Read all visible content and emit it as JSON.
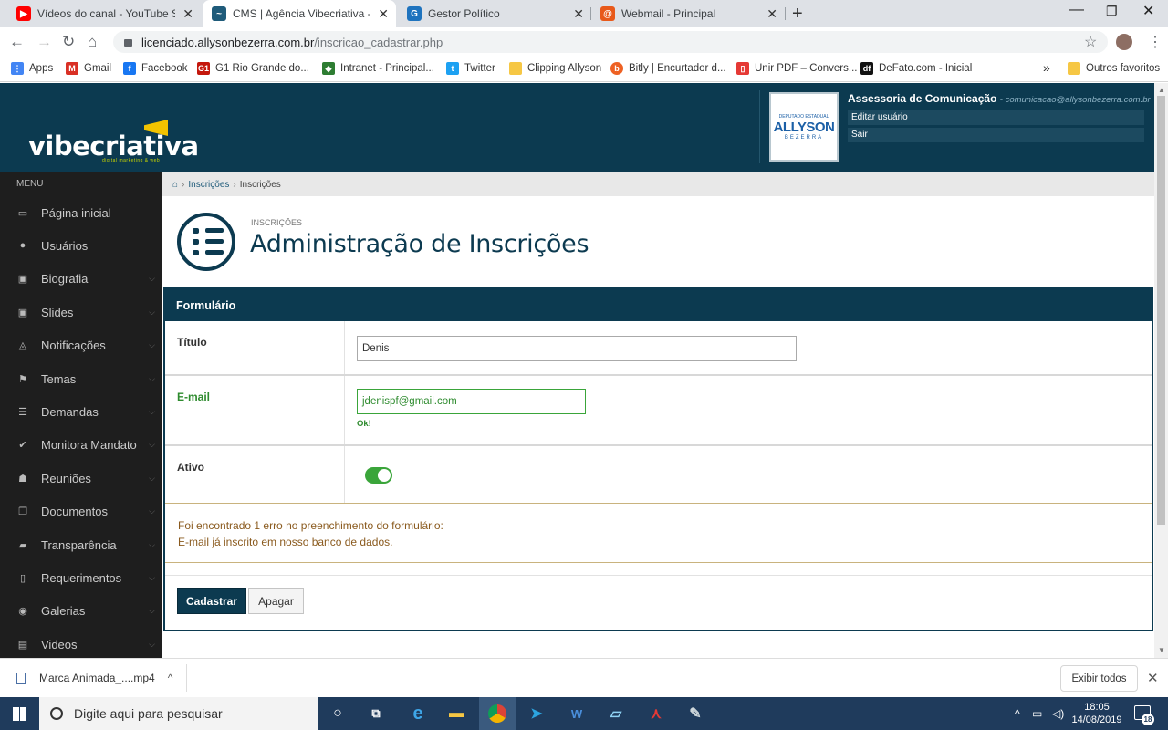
{
  "browser": {
    "tabs": [
      {
        "title": "Vídeos do canal - YouTube Studio",
        "icon": "youtube-icon",
        "color": "#ff0000"
      },
      {
        "title": "CMS | Agência Vibecriativa - digital",
        "icon": "vibecriativa-icon",
        "color": "#1f5b7a"
      },
      {
        "title": "Gestor Político",
        "icon": "gp-icon",
        "color": "#1e73be"
      },
      {
        "title": "Webmail - Principal",
        "icon": "webmail-icon",
        "color": "#e8591a"
      }
    ],
    "url_domain": "licenciado.allysonbezerra.com.br",
    "url_path": "/inscricao_cadastrar.php",
    "bookmarks": [
      {
        "label": "Apps",
        "icon": "apps-grid-icon",
        "color": "#4285f4"
      },
      {
        "label": "Gmail",
        "icon": "gmail-icon",
        "color": "#d93025"
      },
      {
        "label": "Facebook",
        "icon": "facebook-icon",
        "color": "#1877f2"
      },
      {
        "label": "G1 Rio Grande do...",
        "icon": "g1-icon",
        "color": "#c4170c"
      },
      {
        "label": "Intranet - Principal...",
        "icon": "intranet-icon",
        "color": "#2e7d32"
      },
      {
        "label": "Twitter",
        "icon": "twitter-icon",
        "color": "#1da1f2"
      },
      {
        "label": "Clipping Allyson",
        "icon": "folder-icon",
        "color": "#f6c744"
      },
      {
        "label": "Bitly | Encurtador d...",
        "icon": "bitly-icon",
        "color": "#ee6123"
      },
      {
        "label": "Unir PDF – Convers...",
        "icon": "pdf-icon",
        "color": "#e53935"
      },
      {
        "label": "DeFato.com - Inicial",
        "icon": "defato-icon",
        "color": "#111111"
      }
    ],
    "bookmarks_overflow": "»",
    "other_bookmarks": "Outros favoritos"
  },
  "header": {
    "logo_text": "vibecriativa",
    "logo_subtext": "digital marketing & web",
    "avatar": {
      "line1": "DEPUTADO ESTADUAL",
      "line2": "ALLYSON",
      "line3": "BEZERRA"
    },
    "user_name": "Assessoria de Comunicação",
    "user_email": "comunicacao@allysonbezerra.com.br",
    "menu": [
      "Editar usuário",
      "Sair"
    ]
  },
  "sidebar": {
    "title": "MENU",
    "items": [
      {
        "label": "Página inicial",
        "icon": "laptop-icon",
        "glyph": "▭",
        "has_submenu": false
      },
      {
        "label": "Usuários",
        "icon": "user-icon",
        "glyph": "●",
        "has_submenu": false
      },
      {
        "label": "Biografia",
        "icon": "image-icon",
        "glyph": "▣",
        "has_submenu": true
      },
      {
        "label": "Slides",
        "icon": "image-icon",
        "glyph": "▣",
        "has_submenu": true
      },
      {
        "label": "Notificações",
        "icon": "bell-icon",
        "glyph": "◬",
        "has_submenu": true
      },
      {
        "label": "Temas",
        "icon": "flag-icon",
        "glyph": "⚑",
        "has_submenu": true
      },
      {
        "label": "Demandas",
        "icon": "list-icon",
        "glyph": "☰",
        "has_submenu": true
      },
      {
        "label": "Monitora Mandato",
        "icon": "check-icon",
        "glyph": "✔",
        "has_submenu": true
      },
      {
        "label": "Reuniões",
        "icon": "users-icon",
        "glyph": "☗",
        "has_submenu": true
      },
      {
        "label": "Documentos",
        "icon": "documents-icon",
        "glyph": "❐",
        "has_submenu": true
      },
      {
        "label": "Transparência",
        "icon": "folder-open-icon",
        "glyph": "▰",
        "has_submenu": true
      },
      {
        "label": "Requerimentos",
        "icon": "file-icon",
        "glyph": "▯",
        "has_submenu": true
      },
      {
        "label": "Galerias",
        "icon": "camera-icon",
        "glyph": "◉",
        "has_submenu": true
      },
      {
        "label": "Videos",
        "icon": "film-icon",
        "glyph": "▤",
        "has_submenu": true
      }
    ]
  },
  "breadcrumb": {
    "home_icon": "home-icon",
    "items": [
      "Inscrições",
      "Inscrições"
    ]
  },
  "page": {
    "subtitle": "INSCRIÇÕES",
    "title": "Administração de Inscrições"
  },
  "form": {
    "heading": "Formulário",
    "fields": {
      "titulo": {
        "label": "Título",
        "value": "Denis"
      },
      "email": {
        "label": "E-mail",
        "value": "jdenispf@gmail.com",
        "status": "Ok!"
      },
      "ativo": {
        "label": "Ativo",
        "checked": true
      }
    },
    "error_line1": "Foi encontrado 1 erro no preenchimento do formulário:",
    "error_line2": "E-mail já inscrito em nosso banco de dados.",
    "submit_label": "Cadastrar",
    "clear_label": "Apagar"
  },
  "downloads": {
    "file": "Marca Animada_....mp4",
    "show_all": "Exibir todos"
  },
  "taskbar": {
    "search_placeholder": "Digite aqui para pesquisar",
    "time": "18:05",
    "date": "14/08/2019",
    "notifications": "18"
  },
  "colors": {
    "primary": "#0c3a50",
    "success": "#2e8b2e",
    "error_text": "#8a5a1e"
  }
}
